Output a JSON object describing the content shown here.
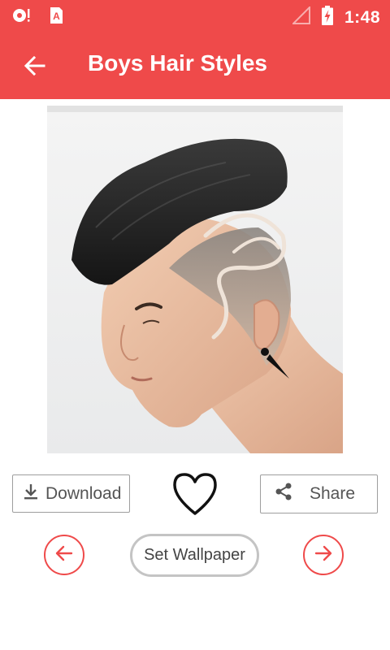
{
  "status_bar": {
    "time": "1:48",
    "icons": [
      "notification-camera-icon",
      "a-notification-icon",
      "signal-icon",
      "battery-charging-icon"
    ]
  },
  "app_bar": {
    "title": "Boys Hair Styles",
    "back_icon": "arrow-left-icon"
  },
  "photo": {
    "subject": "hairstyle-photo"
  },
  "actions": {
    "download_label": "Download",
    "share_label": "Share",
    "favorite_icon": "heart-outline-icon"
  },
  "navigation": {
    "set_wallpaper_label": "Set Wallpaper",
    "prev_icon": "arrow-left-circle-icon",
    "next_icon": "arrow-right-circle-icon"
  },
  "colors": {
    "primary": "#ef4a4a",
    "outline_gray": "#9e9e9e",
    "pill_border": "#c4c4c4"
  }
}
